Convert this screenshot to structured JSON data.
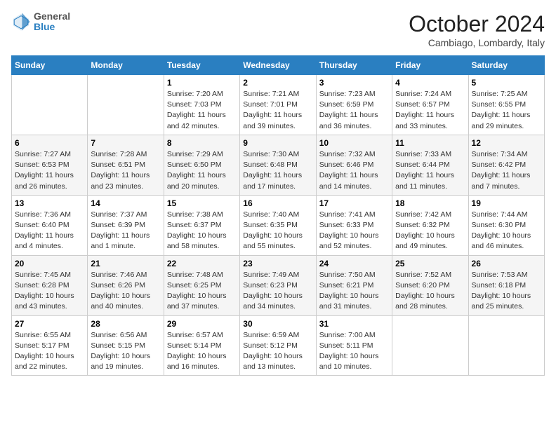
{
  "header": {
    "logo_line1": "General",
    "logo_line2": "Blue",
    "month_title": "October 2024",
    "location": "Cambiago, Lombardy, Italy"
  },
  "columns": [
    "Sunday",
    "Monday",
    "Tuesday",
    "Wednesday",
    "Thursday",
    "Friday",
    "Saturday"
  ],
  "weeks": [
    [
      {
        "day": "",
        "info": ""
      },
      {
        "day": "",
        "info": ""
      },
      {
        "day": "1",
        "info": "Sunrise: 7:20 AM\nSunset: 7:03 PM\nDaylight: 11 hours and 42 minutes."
      },
      {
        "day": "2",
        "info": "Sunrise: 7:21 AM\nSunset: 7:01 PM\nDaylight: 11 hours and 39 minutes."
      },
      {
        "day": "3",
        "info": "Sunrise: 7:23 AM\nSunset: 6:59 PM\nDaylight: 11 hours and 36 minutes."
      },
      {
        "day": "4",
        "info": "Sunrise: 7:24 AM\nSunset: 6:57 PM\nDaylight: 11 hours and 33 minutes."
      },
      {
        "day": "5",
        "info": "Sunrise: 7:25 AM\nSunset: 6:55 PM\nDaylight: 11 hours and 29 minutes."
      }
    ],
    [
      {
        "day": "6",
        "info": "Sunrise: 7:27 AM\nSunset: 6:53 PM\nDaylight: 11 hours and 26 minutes."
      },
      {
        "day": "7",
        "info": "Sunrise: 7:28 AM\nSunset: 6:51 PM\nDaylight: 11 hours and 23 minutes."
      },
      {
        "day": "8",
        "info": "Sunrise: 7:29 AM\nSunset: 6:50 PM\nDaylight: 11 hours and 20 minutes."
      },
      {
        "day": "9",
        "info": "Sunrise: 7:30 AM\nSunset: 6:48 PM\nDaylight: 11 hours and 17 minutes."
      },
      {
        "day": "10",
        "info": "Sunrise: 7:32 AM\nSunset: 6:46 PM\nDaylight: 11 hours and 14 minutes."
      },
      {
        "day": "11",
        "info": "Sunrise: 7:33 AM\nSunset: 6:44 PM\nDaylight: 11 hours and 11 minutes."
      },
      {
        "day": "12",
        "info": "Sunrise: 7:34 AM\nSunset: 6:42 PM\nDaylight: 11 hours and 7 minutes."
      }
    ],
    [
      {
        "day": "13",
        "info": "Sunrise: 7:36 AM\nSunset: 6:40 PM\nDaylight: 11 hours and 4 minutes."
      },
      {
        "day": "14",
        "info": "Sunrise: 7:37 AM\nSunset: 6:39 PM\nDaylight: 11 hours and 1 minute."
      },
      {
        "day": "15",
        "info": "Sunrise: 7:38 AM\nSunset: 6:37 PM\nDaylight: 10 hours and 58 minutes."
      },
      {
        "day": "16",
        "info": "Sunrise: 7:40 AM\nSunset: 6:35 PM\nDaylight: 10 hours and 55 minutes."
      },
      {
        "day": "17",
        "info": "Sunrise: 7:41 AM\nSunset: 6:33 PM\nDaylight: 10 hours and 52 minutes."
      },
      {
        "day": "18",
        "info": "Sunrise: 7:42 AM\nSunset: 6:32 PM\nDaylight: 10 hours and 49 minutes."
      },
      {
        "day": "19",
        "info": "Sunrise: 7:44 AM\nSunset: 6:30 PM\nDaylight: 10 hours and 46 minutes."
      }
    ],
    [
      {
        "day": "20",
        "info": "Sunrise: 7:45 AM\nSunset: 6:28 PM\nDaylight: 10 hours and 43 minutes."
      },
      {
        "day": "21",
        "info": "Sunrise: 7:46 AM\nSunset: 6:26 PM\nDaylight: 10 hours and 40 minutes."
      },
      {
        "day": "22",
        "info": "Sunrise: 7:48 AM\nSunset: 6:25 PM\nDaylight: 10 hours and 37 minutes."
      },
      {
        "day": "23",
        "info": "Sunrise: 7:49 AM\nSunset: 6:23 PM\nDaylight: 10 hours and 34 minutes."
      },
      {
        "day": "24",
        "info": "Sunrise: 7:50 AM\nSunset: 6:21 PM\nDaylight: 10 hours and 31 minutes."
      },
      {
        "day": "25",
        "info": "Sunrise: 7:52 AM\nSunset: 6:20 PM\nDaylight: 10 hours and 28 minutes."
      },
      {
        "day": "26",
        "info": "Sunrise: 7:53 AM\nSunset: 6:18 PM\nDaylight: 10 hours and 25 minutes."
      }
    ],
    [
      {
        "day": "27",
        "info": "Sunrise: 6:55 AM\nSunset: 5:17 PM\nDaylight: 10 hours and 22 minutes."
      },
      {
        "day": "28",
        "info": "Sunrise: 6:56 AM\nSunset: 5:15 PM\nDaylight: 10 hours and 19 minutes."
      },
      {
        "day": "29",
        "info": "Sunrise: 6:57 AM\nSunset: 5:14 PM\nDaylight: 10 hours and 16 minutes."
      },
      {
        "day": "30",
        "info": "Sunrise: 6:59 AM\nSunset: 5:12 PM\nDaylight: 10 hours and 13 minutes."
      },
      {
        "day": "31",
        "info": "Sunrise: 7:00 AM\nSunset: 5:11 PM\nDaylight: 10 hours and 10 minutes."
      },
      {
        "day": "",
        "info": ""
      },
      {
        "day": "",
        "info": ""
      }
    ]
  ]
}
